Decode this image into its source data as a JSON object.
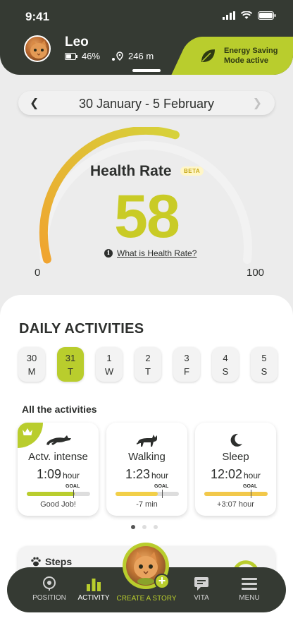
{
  "status_bar": {
    "time": "9:41"
  },
  "pet": {
    "name": "Leo",
    "battery": "46%",
    "distance": "246 m"
  },
  "energy_banner": {
    "line1": "Energy Saving",
    "line2": "Mode active"
  },
  "date_range": {
    "label": "30 January - 5 February"
  },
  "health_rate": {
    "title": "Health Rate",
    "badge": "BETA",
    "value": "58",
    "link": "What is Health Rate?",
    "min_label": "0",
    "max_label": "100",
    "fraction": 0.58
  },
  "daily": {
    "title": "DAILY ACTIVITIES",
    "days": [
      {
        "num": "30",
        "letter": "M"
      },
      {
        "num": "31",
        "letter": "T"
      },
      {
        "num": "1",
        "letter": "W"
      },
      {
        "num": "2",
        "letter": "T"
      },
      {
        "num": "3",
        "letter": "F"
      },
      {
        "num": "4",
        "letter": "S"
      },
      {
        "num": "5",
        "letter": "S"
      }
    ],
    "all_label": "All the activities"
  },
  "activities": [
    {
      "title": "Actv. intense",
      "value": "1:09",
      "unit": "hour",
      "goal": "GOAL",
      "note": "Good Job!",
      "progress": 0.75,
      "color": "#b9cd2d"
    },
    {
      "title": "Walking",
      "value": "1:23",
      "unit": "hour",
      "goal": "GOAL",
      "note": "-7 min",
      "progress": 0.67,
      "color": "#f2cf48"
    },
    {
      "title": "Sleep",
      "value": "12:02",
      "unit": "hour",
      "goal": "GOAL",
      "note": "+3:07 hour",
      "progress": 1.0,
      "color": "#f2c84a"
    }
  ],
  "steps": {
    "label": "Steps"
  },
  "nav": {
    "position": "POSITION",
    "activity": "ACTIVITY",
    "create": "CREATE A STORY",
    "vita": "VITA",
    "menu": "MENU"
  },
  "colors": {
    "accent": "#b9cd2d",
    "dark": "#353a33",
    "gauge_start": "#f0a430",
    "gauge_end": "#d6d23a"
  }
}
